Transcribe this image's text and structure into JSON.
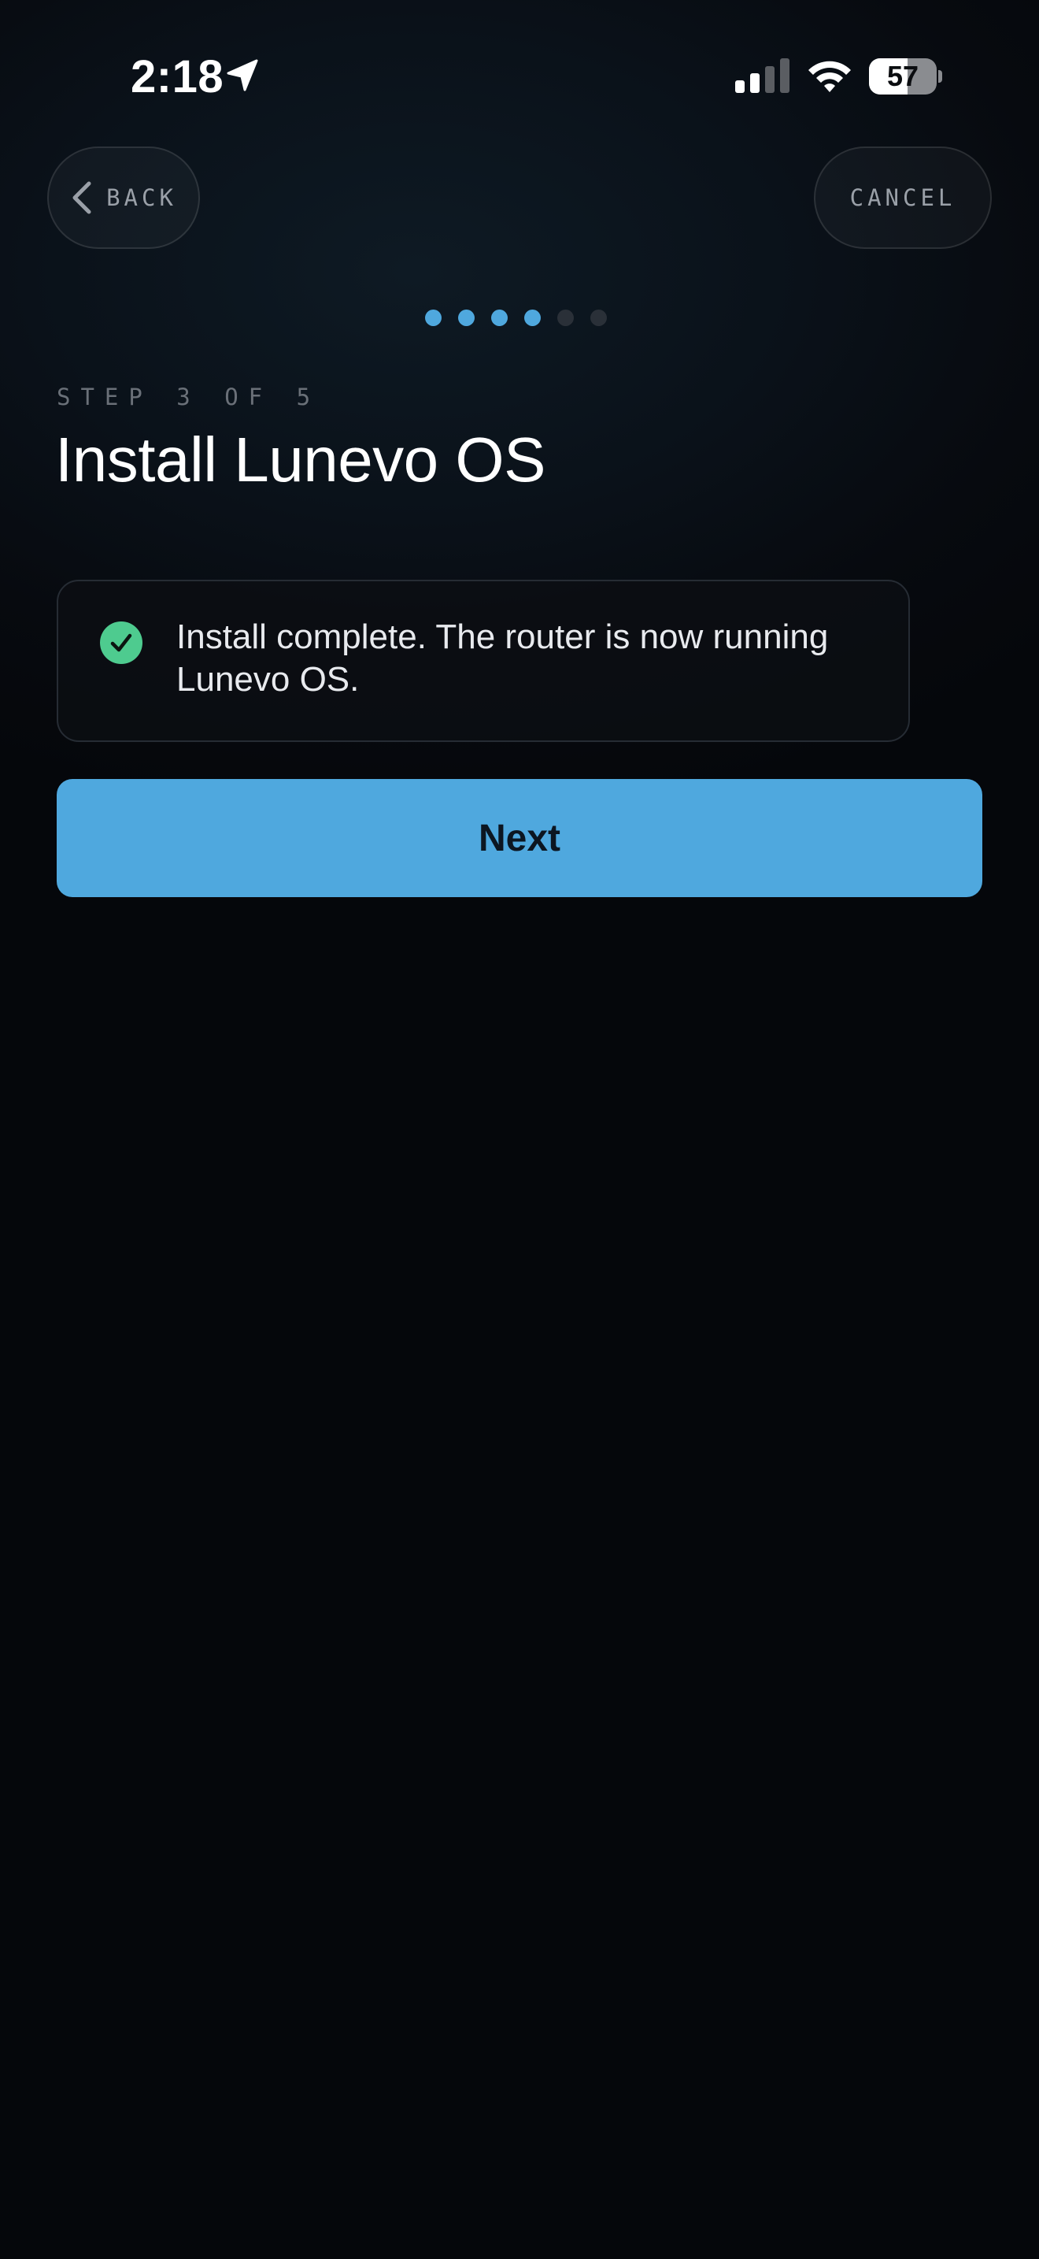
{
  "status_bar": {
    "time": "2:18",
    "battery_level": "57",
    "battery_fraction": 0.57,
    "location_icon": "location-arrow-icon",
    "signal_icon": "cellular-signal-icon",
    "signal_bars_active": 2,
    "signal_bars_total": 4,
    "wifi_icon": "wifi-icon"
  },
  "nav": {
    "back_label": "BACK",
    "back_icon": "chevron-left-icon",
    "cancel_label": "CANCEL"
  },
  "progress": {
    "total_dots": 6,
    "active_dots": 4,
    "active_color": "#4fa8de",
    "inactive_color": "#2a3038"
  },
  "step": {
    "label": "STEP 3 OF 5",
    "title": "Install Lunevo OS"
  },
  "status_card": {
    "icon": "check-circle-icon",
    "icon_color": "#4ecb8f",
    "message": "Install complete. The router is now running Lunevo OS."
  },
  "primary_action": {
    "label": "Next",
    "color": "#4fa8de"
  }
}
